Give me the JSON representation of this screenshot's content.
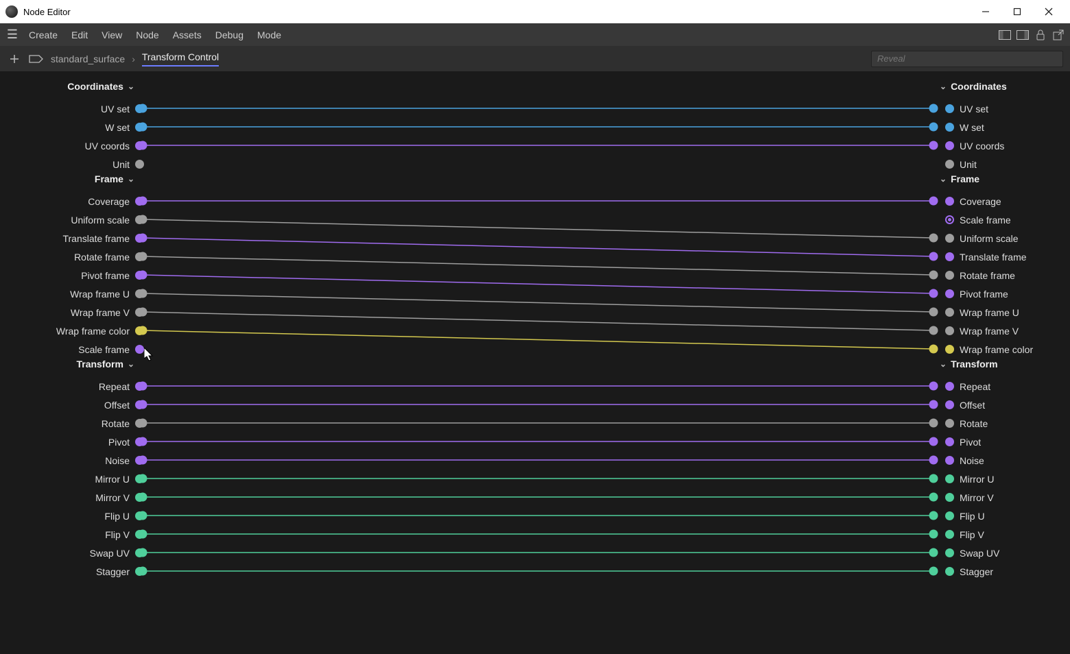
{
  "window": {
    "title": "Node Editor"
  },
  "menubar": {
    "items": [
      "Create",
      "Edit",
      "View",
      "Node",
      "Assets",
      "Debug",
      "Mode"
    ]
  },
  "breadcrumb": {
    "root": "standard_surface",
    "active": "Transform Control"
  },
  "search": {
    "placeholder": "Reveal"
  },
  "colors": {
    "blue": "#4aa3df",
    "purple": "#a06cf0",
    "gray": "#9e9e9e",
    "yellow": "#d4c94f",
    "green": "#4fcf9b"
  },
  "leftGroups": [
    {
      "header": "Coordinates",
      "ports": [
        {
          "id": "uvset",
          "label": "UV set",
          "color": "blue"
        },
        {
          "id": "wset",
          "label": "W set",
          "color": "blue"
        },
        {
          "id": "uvcoords",
          "label": "UV coords",
          "color": "purple"
        },
        {
          "id": "unit",
          "label": "Unit",
          "color": "gray"
        }
      ]
    },
    {
      "header": "Frame",
      "ports": [
        {
          "id": "coverage",
          "label": "Coverage",
          "color": "purple"
        },
        {
          "id": "uniformscale",
          "label": "Uniform scale",
          "color": "gray"
        },
        {
          "id": "translateframe",
          "label": "Translate frame",
          "color": "purple"
        },
        {
          "id": "rotateframe",
          "label": "Rotate frame",
          "color": "gray"
        },
        {
          "id": "pivotframe",
          "label": "Pivot frame",
          "color": "purple"
        },
        {
          "id": "wrapframeu",
          "label": "Wrap frame U",
          "color": "gray"
        },
        {
          "id": "wrapframev",
          "label": "Wrap frame V",
          "color": "gray"
        },
        {
          "id": "wrapframecolor",
          "label": "Wrap frame color",
          "color": "yellow"
        },
        {
          "id": "scaleframe",
          "label": "Scale frame",
          "color": "purple"
        }
      ]
    },
    {
      "header": "Transform",
      "ports": [
        {
          "id": "repeat",
          "label": "Repeat",
          "color": "purple"
        },
        {
          "id": "offset",
          "label": "Offset",
          "color": "purple"
        },
        {
          "id": "rotate",
          "label": "Rotate",
          "color": "gray"
        },
        {
          "id": "pivot",
          "label": "Pivot",
          "color": "purple"
        },
        {
          "id": "noise",
          "label": "Noise",
          "color": "purple"
        },
        {
          "id": "mirroru",
          "label": "Mirror U",
          "color": "green"
        },
        {
          "id": "mirrorv",
          "label": "Mirror V",
          "color": "green"
        },
        {
          "id": "flipu",
          "label": "Flip U",
          "color": "green"
        },
        {
          "id": "flipv",
          "label": "Flip V",
          "color": "green"
        },
        {
          "id": "swapuv",
          "label": "Swap UV",
          "color": "green"
        },
        {
          "id": "stagger",
          "label": "Stagger",
          "color": "green"
        }
      ]
    }
  ],
  "rightGroups": [
    {
      "header": "Coordinates",
      "ports": [
        {
          "id": "r-uvset",
          "label": "UV set",
          "color": "blue"
        },
        {
          "id": "r-wset",
          "label": "W set",
          "color": "blue"
        },
        {
          "id": "r-uvcoords",
          "label": "UV coords",
          "color": "purple"
        },
        {
          "id": "r-unit",
          "label": "Unit",
          "color": "gray"
        }
      ]
    },
    {
      "header": "Frame",
      "ports": [
        {
          "id": "r-coverage",
          "label": "Coverage",
          "color": "purple"
        },
        {
          "id": "r-scaleframe",
          "label": "Scale frame",
          "color": "purple",
          "ring": true
        },
        {
          "id": "r-uniformscale",
          "label": "Uniform scale",
          "color": "gray"
        },
        {
          "id": "r-translateframe",
          "label": "Translate frame",
          "color": "purple"
        },
        {
          "id": "r-rotateframe",
          "label": "Rotate frame",
          "color": "gray"
        },
        {
          "id": "r-pivotframe",
          "label": "Pivot frame",
          "color": "purple"
        },
        {
          "id": "r-wrapframeu",
          "label": "Wrap frame U",
          "color": "gray"
        },
        {
          "id": "r-wrapframev",
          "label": "Wrap frame V",
          "color": "gray"
        },
        {
          "id": "r-wrapframecolor",
          "label": "Wrap frame color",
          "color": "yellow"
        }
      ]
    },
    {
      "header": "Transform",
      "ports": [
        {
          "id": "r-repeat",
          "label": "Repeat",
          "color": "purple"
        },
        {
          "id": "r-offset",
          "label": "Offset",
          "color": "purple"
        },
        {
          "id": "r-rotate",
          "label": "Rotate",
          "color": "gray"
        },
        {
          "id": "r-pivot",
          "label": "Pivot",
          "color": "purple"
        },
        {
          "id": "r-noise",
          "label": "Noise",
          "color": "purple"
        },
        {
          "id": "r-mirroru",
          "label": "Mirror U",
          "color": "green"
        },
        {
          "id": "r-mirrorv",
          "label": "Mirror V",
          "color": "green"
        },
        {
          "id": "r-flipu",
          "label": "Flip U",
          "color": "green"
        },
        {
          "id": "r-flipv",
          "label": "Flip V",
          "color": "green"
        },
        {
          "id": "r-swapuv",
          "label": "Swap UV",
          "color": "green"
        },
        {
          "id": "r-stagger",
          "label": "Stagger",
          "color": "green"
        }
      ]
    }
  ],
  "connections": [
    {
      "from": "uvset",
      "to": "r-uvset"
    },
    {
      "from": "wset",
      "to": "r-wset"
    },
    {
      "from": "uvcoords",
      "to": "r-uvcoords"
    },
    {
      "from": "coverage",
      "to": "r-coverage"
    },
    {
      "from": "uniformscale",
      "to": "r-uniformscale"
    },
    {
      "from": "translateframe",
      "to": "r-translateframe"
    },
    {
      "from": "rotateframe",
      "to": "r-rotateframe"
    },
    {
      "from": "pivotframe",
      "to": "r-pivotframe"
    },
    {
      "from": "wrapframeu",
      "to": "r-wrapframeu"
    },
    {
      "from": "wrapframev",
      "to": "r-wrapframev"
    },
    {
      "from": "wrapframecolor",
      "to": "r-wrapframecolor"
    },
    {
      "from": "repeat",
      "to": "r-repeat"
    },
    {
      "from": "offset",
      "to": "r-offset"
    },
    {
      "from": "rotate",
      "to": "r-rotate"
    },
    {
      "from": "pivot",
      "to": "r-pivot"
    },
    {
      "from": "noise",
      "to": "r-noise"
    },
    {
      "from": "mirroru",
      "to": "r-mirroru"
    },
    {
      "from": "mirrorv",
      "to": "r-mirrorv"
    },
    {
      "from": "flipu",
      "to": "r-flipu"
    },
    {
      "from": "flipv",
      "to": "r-flipv"
    },
    {
      "from": "swapuv",
      "to": "r-swapuv"
    },
    {
      "from": "stagger",
      "to": "r-stagger"
    }
  ],
  "cursor": {
    "port": "scaleframe"
  }
}
